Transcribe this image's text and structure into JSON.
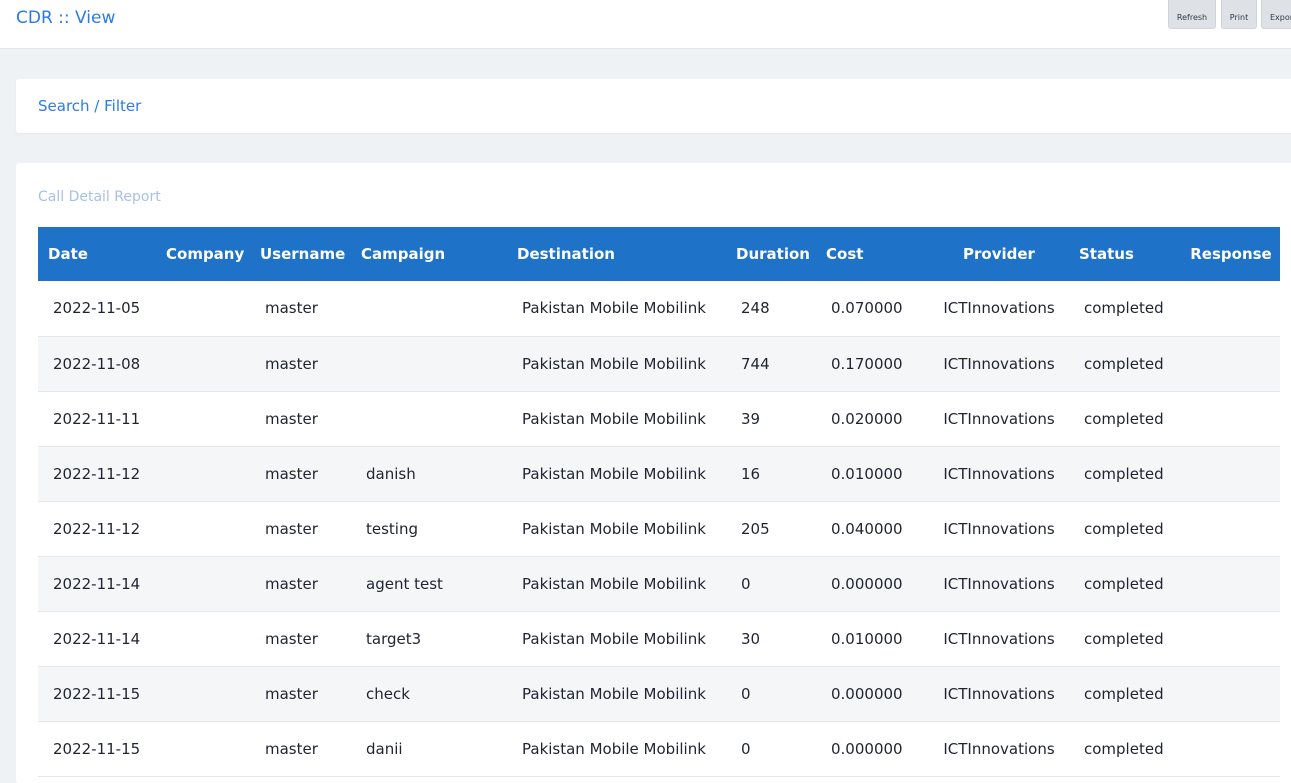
{
  "header": {
    "title": "CDR :: View",
    "buttons": {
      "refresh": "Refresh",
      "print": "Print",
      "export": "Export"
    }
  },
  "filter": {
    "label": "Search / Filter"
  },
  "report": {
    "title": "Call Detail Report",
    "columns": {
      "date": "Date",
      "company": "Company",
      "username": "Username",
      "campaign": "Campaign",
      "destination": "Destination",
      "duration": "Duration",
      "cost": "Cost",
      "provider": "Provider",
      "status": "Status",
      "response": "Response"
    },
    "rows": [
      {
        "date": "2022-11-05",
        "company": "",
        "username": "master",
        "campaign": "",
        "destination": "Pakistan Mobile Mobilink",
        "duration": "248",
        "cost": "0.070000",
        "provider": "ICTInnovations",
        "status": "completed",
        "response": ""
      },
      {
        "date": "2022-11-08",
        "company": "",
        "username": "master",
        "campaign": "",
        "destination": "Pakistan Mobile Mobilink",
        "duration": "744",
        "cost": "0.170000",
        "provider": "ICTInnovations",
        "status": "completed",
        "response": ""
      },
      {
        "date": "2022-11-11",
        "company": "",
        "username": "master",
        "campaign": "",
        "destination": "Pakistan Mobile Mobilink",
        "duration": "39",
        "cost": "0.020000",
        "provider": "ICTInnovations",
        "status": "completed",
        "response": ""
      },
      {
        "date": "2022-11-12",
        "company": "",
        "username": "master",
        "campaign": "danish",
        "destination": "Pakistan Mobile Mobilink",
        "duration": "16",
        "cost": "0.010000",
        "provider": "ICTInnovations",
        "status": "completed",
        "response": ""
      },
      {
        "date": "2022-11-12",
        "company": "",
        "username": "master",
        "campaign": "testing",
        "destination": "Pakistan Mobile Mobilink",
        "duration": "205",
        "cost": "0.040000",
        "provider": "ICTInnovations",
        "status": "completed",
        "response": ""
      },
      {
        "date": "2022-11-14",
        "company": "",
        "username": "master",
        "campaign": "agent test",
        "destination": "Pakistan Mobile Mobilink",
        "duration": "0",
        "cost": "0.000000",
        "provider": "ICTInnovations",
        "status": "completed",
        "response": ""
      },
      {
        "date": "2022-11-14",
        "company": "",
        "username": "master",
        "campaign": "target3",
        "destination": "Pakistan Mobile Mobilink",
        "duration": "30",
        "cost": "0.010000",
        "provider": "ICTInnovations",
        "status": "completed",
        "response": ""
      },
      {
        "date": "2022-11-15",
        "company": "",
        "username": "master",
        "campaign": "check",
        "destination": "Pakistan Mobile Mobilink",
        "duration": "0",
        "cost": "0.000000",
        "provider": "ICTInnovations",
        "status": "completed",
        "response": ""
      },
      {
        "date": "2022-11-15",
        "company": "",
        "username": "master",
        "campaign": "danii",
        "destination": "Pakistan Mobile Mobilink",
        "duration": "0",
        "cost": "0.000000",
        "provider": "ICTInnovations",
        "status": "completed",
        "response": ""
      }
    ]
  }
}
